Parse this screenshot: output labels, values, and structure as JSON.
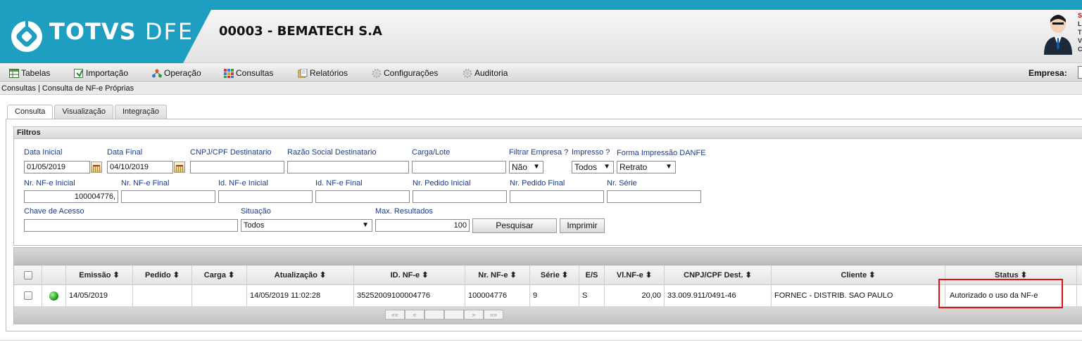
{
  "app": {
    "logo_brand": "TOTVS",
    "logo_product": "DFE",
    "company": "00003 - BEMATECH S.A"
  },
  "user": {
    "lines": [
      "S",
      "L",
      "T",
      "V",
      "C"
    ]
  },
  "menu": {
    "items": [
      {
        "label": "Tabelas",
        "icon": "table-icon"
      },
      {
        "label": "Importação",
        "icon": "import-icon"
      },
      {
        "label": "Operação",
        "icon": "operation-icon"
      },
      {
        "label": "Consultas",
        "icon": "grid-icon"
      },
      {
        "label": "Relatórios",
        "icon": "report-icon"
      },
      {
        "label": "Configurações",
        "icon": "gear-icon"
      },
      {
        "label": "Auditoria",
        "icon": "gear-icon"
      }
    ],
    "empresa_label": "Empresa:"
  },
  "breadcrumb": "Consultas | Consulta de NF-e Próprias",
  "tabs": [
    "Consulta",
    "Visualização",
    "Integração"
  ],
  "filtros": {
    "title": "Filtros",
    "data_inicial": {
      "label": "Data Inicial",
      "value": "01/05/2019"
    },
    "data_final": {
      "label": "Data Final",
      "value": "04/10/2019"
    },
    "cnpj_dest": {
      "label": "CNPJ/CPF Destinatario",
      "value": ""
    },
    "razao_social": {
      "label": "Razão Social Destinatario",
      "value": ""
    },
    "carga_lote": {
      "label": "Carga/Lote",
      "value": ""
    },
    "filtrar_empresa": {
      "label": "Filtrar Empresa ?",
      "value": "Não"
    },
    "impresso": {
      "label": "Impresso ?",
      "value": "Todos"
    },
    "forma_impressao": {
      "label": "Forma Impressão DANFE",
      "value": "Retrato"
    },
    "nr_nfe_inicial": {
      "label": "Nr. NF-e Inicial",
      "value": "100004776,"
    },
    "nr_nfe_final": {
      "label": "Nr. NF-e Final",
      "value": ""
    },
    "id_nfe_inicial": {
      "label": "Id. NF-e Inicial",
      "value": ""
    },
    "id_nfe_final": {
      "label": "Id. NF-e Final",
      "value": ""
    },
    "nr_pedido_inicial": {
      "label": "Nr. Pedido Inicial",
      "value": ""
    },
    "nr_pedido_final": {
      "label": "Nr. Pedido Final",
      "value": ""
    },
    "nr_serie": {
      "label": "Nr. Série",
      "value": ""
    },
    "chave_acesso": {
      "label": "Chave de Acesso",
      "value": ""
    },
    "situacao": {
      "label": "Situação",
      "value": "Todos"
    },
    "max_resultados": {
      "label": "Max. Resultados",
      "value": "100"
    },
    "pesquisar": "Pesquisar",
    "imprimir": "Imprimir"
  },
  "grid": {
    "columns": [
      "Emissão ⬍",
      "Pedido ⬍",
      "Carga ⬍",
      "Atualização ⬍",
      "ID. NF-e ⬍",
      "Nr. NF-e ⬍",
      "Série ⬍",
      "E/S",
      "Vl.NF-e ⬍",
      "CNPJ/CPF Dest. ⬍",
      "Cliente ⬍",
      "Status ⬍"
    ],
    "rows": [
      {
        "status_color": "#1fa01f",
        "emissao": "14/05/2019",
        "pedido": "",
        "carga": "",
        "atualizacao": "14/05/2019 11:02:28",
        "id_nfe": "35252009100004776",
        "nr_nfe": "100004776",
        "serie": "9",
        "es": "S",
        "vl_nfe": "20,00",
        "cnpj_dest": "33.009.911/0491-46",
        "cliente": "FORNEC - DISTRIB. SAO PAULO",
        "status": "Autorizado o uso da NF-e"
      }
    ],
    "pager": [
      "««",
      "«",
      "",
      "",
      "»",
      "»»"
    ]
  },
  "colors": {
    "brand_blue": "#1e9fc2",
    "highlight": "#e0101a"
  }
}
